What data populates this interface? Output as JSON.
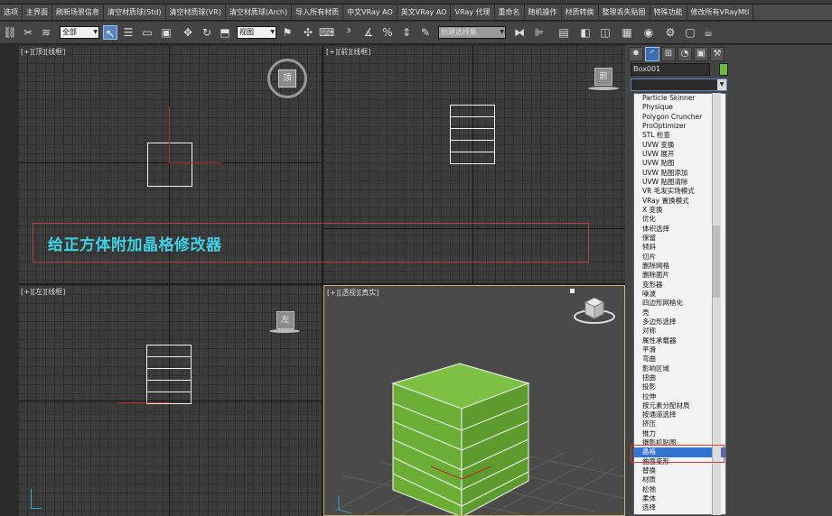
{
  "menubar": {},
  "command_bar": {
    "items": [
      "选项",
      "主界面",
      "刷新场景信息",
      "清空材质球(Std)",
      "清空材质球(VR)",
      "清空材质球(Arch)",
      "导入所有材质",
      "中文VRay AO",
      "英文VRay AO",
      "VRay 代理",
      "重命名",
      "随机操作",
      "材质转换",
      "整理丢失贴图",
      "特殊功能",
      "修改所有VRayMtl"
    ]
  },
  "toolbar": {
    "selection_filter": "全部",
    "reference_coord": "视图",
    "named_selection": "创建选择集"
  },
  "viewports": {
    "top_label": "[+][顶][线框]",
    "front_label": "[+][前][线框]",
    "left_label": "[+][左][线框]",
    "persp_label": "[+][透视][真实]",
    "viewcube_top": "顶",
    "viewcube_front": "前",
    "viewcube_left": "左"
  },
  "annotation": {
    "text": "给正方体附加晶格修改器"
  },
  "command_panel": {
    "object_name": "Box001",
    "object_color": "#6fb83e",
    "modifier_list": [
      "Particle Skinner",
      "Physique",
      "Polygon Cruncher",
      "ProOptimizer",
      "STL 检查",
      "UVW 变换",
      "UVW 展开",
      "UVW 贴图",
      "UVW 贴图添加",
      "UVW 贴图清除",
      "VR 毛发实场模式",
      "VRay 置换模式",
      "X 变换",
      "优化",
      "体积选择",
      "保留",
      "倾斜",
      "切片",
      "删除网格",
      "删除面片",
      "变形器",
      "噪波",
      "四边形网格化",
      "壳",
      "多边形选择",
      "对称",
      "属性承载器",
      "平滑",
      "弯曲",
      "影响区域",
      "扭曲",
      "投影",
      "拉伸",
      "按元素分配材质",
      "按通道选择",
      "挤压",
      "推力",
      "摄影机贴图",
      "晶格",
      "曲面变形",
      "替换",
      "材质",
      "松弛",
      "柔体",
      "选择"
    ],
    "selected_modifier": "晶格"
  }
}
